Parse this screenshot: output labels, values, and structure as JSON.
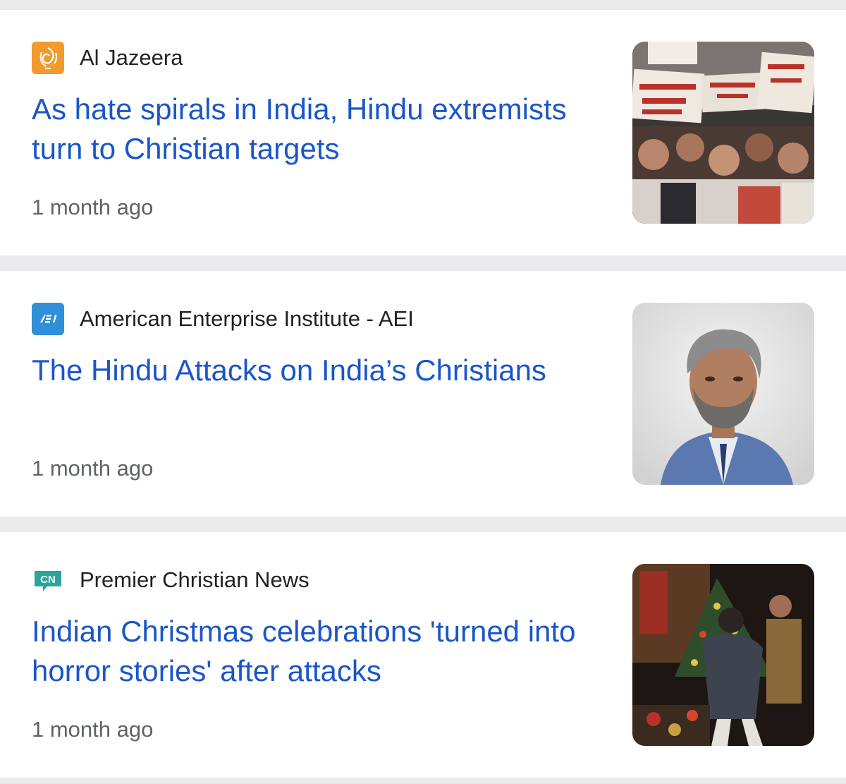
{
  "articles": [
    {
      "source": "Al Jazeera",
      "source_icon": "al-jazeera-logo-icon",
      "headline": "As hate spirals in India, Hindu extremists turn to Christian targets",
      "time": "1 month ago",
      "thumbnail": "protest-crowd-photo"
    },
    {
      "source": "American Enterprise Institute - AEI",
      "source_icon": "aei-logo-icon",
      "headline": "The Hindu Attacks on India’s Christians",
      "time": "1 month ago",
      "thumbnail": "man-portrait-photo"
    },
    {
      "source": "Premier Christian News",
      "source_icon": "premier-christian-news-logo-icon",
      "headline": "Indian Christmas celebrations 'turned into horror stories' after attacks",
      "time": "1 month ago",
      "thumbnail": "christmas-attack-photo"
    }
  ],
  "colors": {
    "headline": "#1a56c9",
    "source": "#202124",
    "time": "#5f6368",
    "background": "#ebebed",
    "card": "#ffffff"
  }
}
